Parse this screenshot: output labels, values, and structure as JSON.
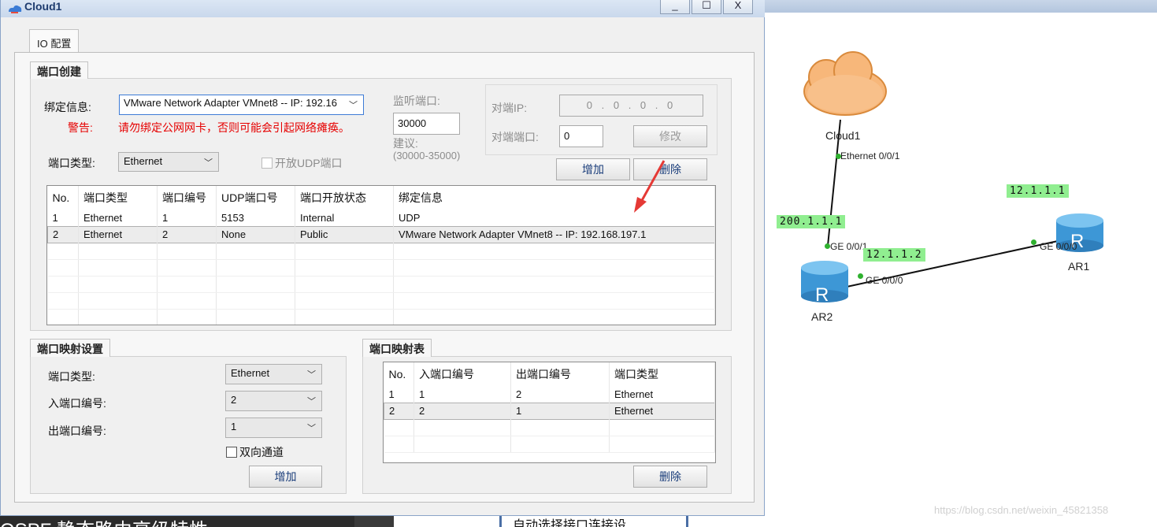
{
  "window": {
    "title": "Cloud1",
    "min": "_",
    "max": "☐",
    "close": "X"
  },
  "tab": "IO 配置",
  "port_create": {
    "section": "端口创建",
    "bind_label": "绑定信息:",
    "bind_value": "VMware Network Adapter VMnet8 -- IP: 192.16",
    "warn_label": "警告:",
    "warn_text": "请勿绑定公网网卡，否则可能会引起网络瘫痪。",
    "type_label": "端口类型:",
    "type_value": "Ethernet",
    "udp_checkbox": "开放UDP端口",
    "listen_label": "监听端口:",
    "listen_value": "30000",
    "suggest_label": "建议:",
    "suggest_range": "(30000-35000)",
    "peer_ip_label": "对端IP:",
    "peer_ip_value": "0 . 0 . 0 . 0",
    "peer_port_label": "对端端口:",
    "peer_port_value": "0",
    "modify_btn": "修改",
    "add_btn": "增加",
    "delete_btn": "删除",
    "table": {
      "headers": [
        "No.",
        "端口类型",
        "端口编号",
        "UDP端口号",
        "端口开放状态",
        "绑定信息"
      ],
      "rows": [
        [
          "1",
          "Ethernet",
          "1",
          "5153",
          "Internal",
          "UDP"
        ],
        [
          "2",
          "Ethernet",
          "2",
          "None",
          "Public",
          "VMware Network Adapter VMnet8 -- IP: 192.168.197.1"
        ]
      ]
    }
  },
  "map_settings": {
    "section": "端口映射设置",
    "type_label": "端口类型:",
    "type_value": "Ethernet",
    "in_label": "入端口编号:",
    "in_value": "2",
    "out_label": "出端口编号:",
    "out_value": "1",
    "bidir": "双向通道",
    "add_btn": "增加"
  },
  "map_table": {
    "section": "端口映射表",
    "headers": [
      "No.",
      "入端口编号",
      "出端口编号",
      "端口类型"
    ],
    "rows": [
      [
        "1",
        "1",
        "2",
        "Ethernet"
      ],
      [
        "2",
        "2",
        "1",
        "Ethernet"
      ]
    ],
    "delete_btn": "删除"
  },
  "topology": {
    "cloud": "Cloud1",
    "cloud_port": "Ethernet 0/0/1",
    "ar2": "AR2",
    "ar1": "AR1",
    "ar2_port_up": "GE 0/0/1",
    "ar2_port_right": "GE 0/0/0",
    "ar1_port": "GE 0/0/0",
    "ip_ar2_up": "200.1.1.1",
    "ip_ar2_right": "12.1.1.2",
    "ip_ar1": "12.1.1.1",
    "router_letter": "R"
  },
  "background": {
    "bottom_left": "OSPF 静态路由高级特性",
    "bottom_mid": "自动选择接口连接设",
    "watermark": "https://blog.csdn.net/weixin_45821358"
  },
  "colors": {
    "ip_label": "#90ee90",
    "router": "#4aa3df",
    "link": "#111111",
    "warning": "#e60000"
  }
}
